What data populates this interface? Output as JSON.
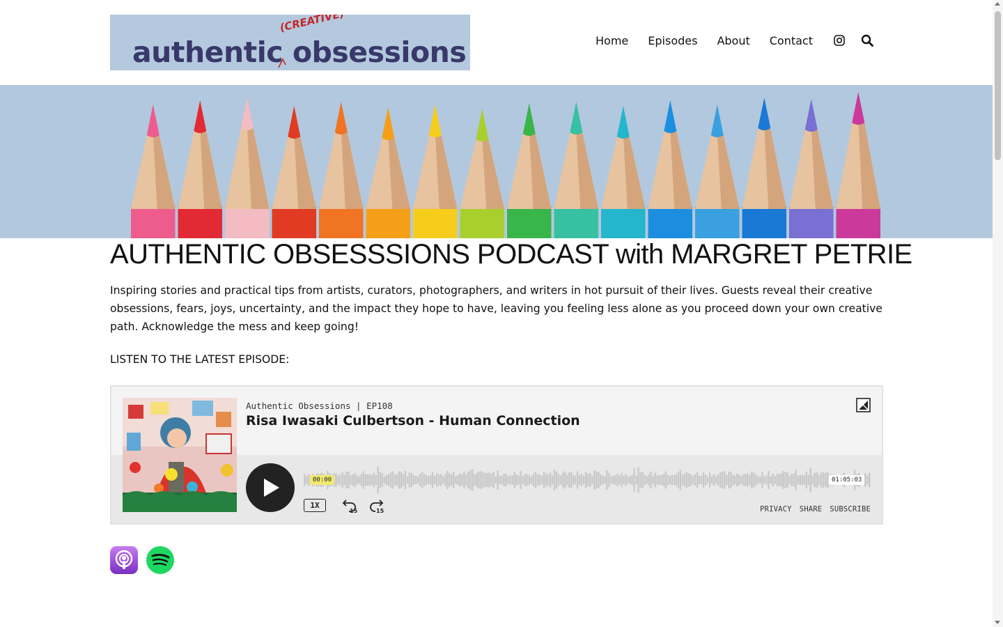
{
  "header": {
    "logo": {
      "main_text": "authentic obsessions",
      "insert_text": "(CREATIVE)",
      "background": "#b4c9de",
      "text_color": "#38386a",
      "accent_color": "#c2272d"
    },
    "nav": {
      "items": [
        {
          "label": "Home"
        },
        {
          "label": "Episodes"
        },
        {
          "label": "About"
        },
        {
          "label": "Contact"
        }
      ],
      "icons": [
        "instagram-icon",
        "search-icon"
      ]
    }
  },
  "banner": {
    "background": "#b2c8de",
    "pencil_colors": [
      "#ee5c8e",
      "#e22a34",
      "#f2bcc2",
      "#e23b23",
      "#f07422",
      "#f59f18",
      "#f6cd1a",
      "#a9cf2e",
      "#39b54a",
      "#37c1a2",
      "#23b6cc",
      "#1c8ee0",
      "#3aa0e0",
      "#1a79d4",
      "#7a6fd2",
      "#cb3a9a"
    ]
  },
  "main": {
    "title": "AUTHENTIC OBSESSSIONS PODCAST with MARGRET PETRIE",
    "intro": "Inspiring stories and practical tips from artists, curators, photographers, and writers in hot pursuit of their lives. Guests reveal their creative obsessions, fears, joys, uncertainty, and the impact they hope to have, leaving you feeling less alone as you proceed down your own creative path. Acknowledge the mess and keep going!",
    "latest_label": "LISTEN TO THE LATEST EPISODE:"
  },
  "player": {
    "show_line": "Authentic Obsessions | EP108",
    "episode_title": "Risa Iwasaki Culbertson - Human Connection",
    "time_current": "00:00",
    "time_total": "01:05:03",
    "speed": "1X",
    "skip_back": "15",
    "skip_forward": "15",
    "links": [
      "PRIVACY",
      "SHARE",
      "SUBSCRIBE"
    ],
    "progress": 0
  },
  "subscribe_badges": [
    "apple-podcasts-icon",
    "spotify-icon"
  ]
}
